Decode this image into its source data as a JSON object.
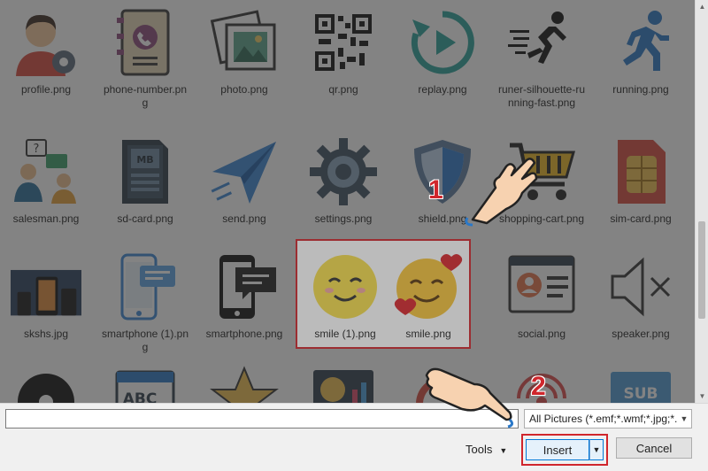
{
  "files": [
    {
      "name": "profile.png",
      "icon": "profile-user-gear-icon"
    },
    {
      "name": "phone-number.png",
      "icon": "phone-book-icon"
    },
    {
      "name": "photo.png",
      "icon": "photo-frame-icon"
    },
    {
      "name": "qr.png",
      "icon": "qr-code-icon"
    },
    {
      "name": "replay.png",
      "icon": "replay-icon"
    },
    {
      "name": "runer-silhouette-running-fast.png",
      "icon": "runner-silhouette-icon"
    },
    {
      "name": "running.png",
      "icon": "running-man-icon"
    },
    {
      "name": "salesman.png",
      "icon": "salesman-chat-icon"
    },
    {
      "name": "sd-card.png",
      "icon": "sd-card-icon"
    },
    {
      "name": "send.png",
      "icon": "paper-plane-icon"
    },
    {
      "name": "settings.png",
      "icon": "gear-icon"
    },
    {
      "name": "shield.png",
      "icon": "shield-icon"
    },
    {
      "name": "shopping-cart.png",
      "icon": "shopping-cart-icon"
    },
    {
      "name": "sim-card.png",
      "icon": "sim-card-icon"
    },
    {
      "name": "skshs.jpg",
      "icon": "phone-photo-icon"
    },
    {
      "name": "smartphone (1).png",
      "icon": "smartphone-chat-icon"
    },
    {
      "name": "smartphone.png",
      "icon": "smartphone-message-icon"
    },
    {
      "name": "smile (1).png",
      "icon": "smile-face-icon"
    },
    {
      "name": "smile.png",
      "icon": "smile-hearts-icon"
    },
    {
      "name": "social.png",
      "icon": "social-profile-icon"
    },
    {
      "name": "speaker.png",
      "icon": "speaker-mute-icon"
    }
  ],
  "partial_row": [
    "vinyl-icon",
    "abc-card-icon",
    "star-icon",
    "money-chart-icon",
    "alarm-clock-icon",
    "signal-icon",
    "sub-icon"
  ],
  "sd_card_label": "MB",
  "partial_row_labels": {
    "abc": "ABC",
    "sub": "SUB"
  },
  "filename_input": {
    "value": ""
  },
  "filetype": {
    "selected": "All Pictures (*.emf;*.wmf;*.jpg;*.j"
  },
  "tools": {
    "label": "Tools"
  },
  "insert": {
    "label": "Insert"
  },
  "cancel": {
    "label": "Cancel"
  },
  "annotations": {
    "step1": "1",
    "step2": "2"
  },
  "colors": {
    "highlight": "#d0262c",
    "accent": "#0078d7"
  }
}
